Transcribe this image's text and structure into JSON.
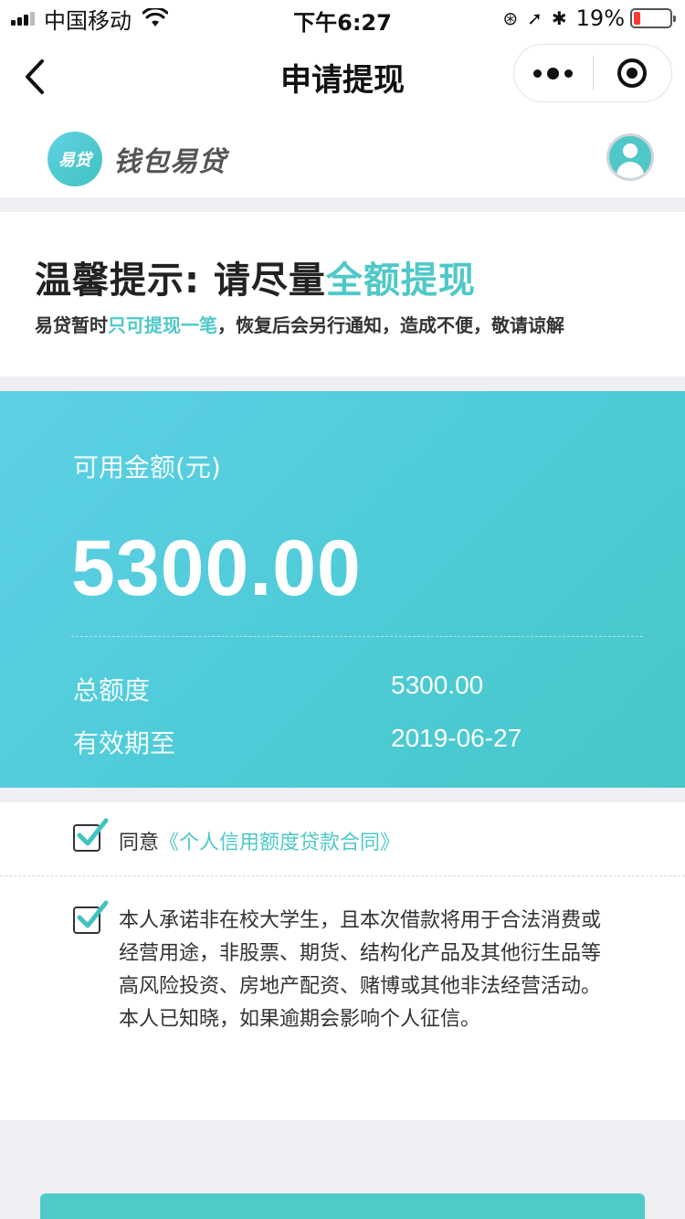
{
  "status_bar": {
    "carrier": "中国移动",
    "time": "下午6:27",
    "battery_percent": "19%",
    "battery_level": 0.19
  },
  "nav": {
    "title": "申请提现"
  },
  "brand": {
    "logo_text": "易贷",
    "name": "钱包易贷"
  },
  "tip": {
    "title_prefix": "温馨提示: 请尽量",
    "title_highlight": "全额提现",
    "sub_prefix": "易贷暂时",
    "sub_highlight": "只可提现一笔",
    "sub_suffix": "，恢复后会另行通知，造成不便，敬请谅解"
  },
  "amount": {
    "label": "可用金额(元)",
    "value": "5300.00",
    "total_label": "总额度",
    "total_value": "5300.00",
    "expire_label": "有效期至",
    "expire_value": "2019-06-27"
  },
  "agreement": {
    "agree_prefix": "同意",
    "contract_link": "《个人信用额度贷款合同》",
    "agree_checked": true,
    "pledge_text": "本人承诺非在校大学生，且本次借款将用于合法消费或经营用途，非股票、期货、结构化产品及其他衍生品等高风险投资、房地产配资、赌博或其他非法经营活动。本人已知晓，如果逾期会影响个人征信。",
    "pledge_checked": true
  },
  "colors": {
    "accent": "#4fc8c8",
    "card_start": "#5dd0e6",
    "card_end": "#47c7c9"
  }
}
